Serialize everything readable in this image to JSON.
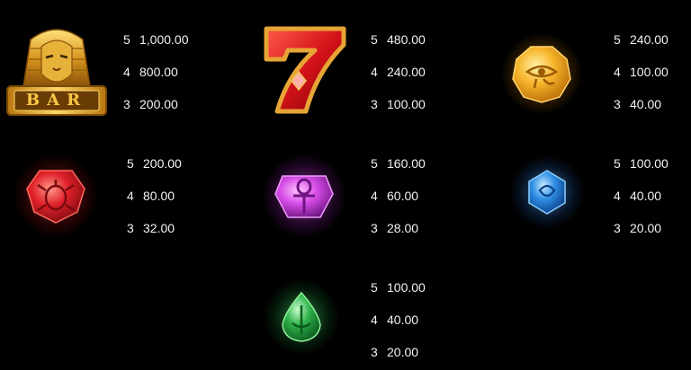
{
  "paytable": [
    {
      "symbol": "pharaoh-bar",
      "label": "BAR",
      "payouts": [
        {
          "count": "5",
          "value": "1,000.00"
        },
        {
          "count": "4",
          "value": "800.00"
        },
        {
          "count": "3",
          "value": "200.00"
        }
      ]
    },
    {
      "symbol": "lucky-seven",
      "payouts": [
        {
          "count": "5",
          "value": "480.00"
        },
        {
          "count": "4",
          "value": "240.00"
        },
        {
          "count": "3",
          "value": "100.00"
        }
      ]
    },
    {
      "symbol": "eye-of-horus-gem",
      "payouts": [
        {
          "count": "5",
          "value": "240.00"
        },
        {
          "count": "4",
          "value": "100.00"
        },
        {
          "count": "3",
          "value": "40.00"
        }
      ]
    },
    {
      "symbol": "scarab-red-gem",
      "payouts": [
        {
          "count": "5",
          "value": "200.00"
        },
        {
          "count": "4",
          "value": "80.00"
        },
        {
          "count": "3",
          "value": "32.00"
        }
      ]
    },
    {
      "symbol": "ankh-purple-gem",
      "payouts": [
        {
          "count": "5",
          "value": "160.00"
        },
        {
          "count": "4",
          "value": "60.00"
        },
        {
          "count": "3",
          "value": "28.00"
        }
      ]
    },
    {
      "symbol": "blue-gem",
      "payouts": [
        {
          "count": "5",
          "value": "100.00"
        },
        {
          "count": "4",
          "value": "40.00"
        },
        {
          "count": "3",
          "value": "20.00"
        }
      ]
    },
    {
      "symbol": "green-gem",
      "payouts": [
        {
          "count": "5",
          "value": "100.00"
        },
        {
          "count": "4",
          "value": "40.00"
        },
        {
          "count": "3",
          "value": "20.00"
        }
      ]
    }
  ],
  "colors": {
    "background": "#000000",
    "text": "#f2f2f2",
    "gold": "#e0a52a",
    "red": "#e0212a",
    "orange": "#f5a623",
    "purple": "#d84ee8",
    "blue": "#2f8fe6",
    "green": "#2fb34a"
  }
}
